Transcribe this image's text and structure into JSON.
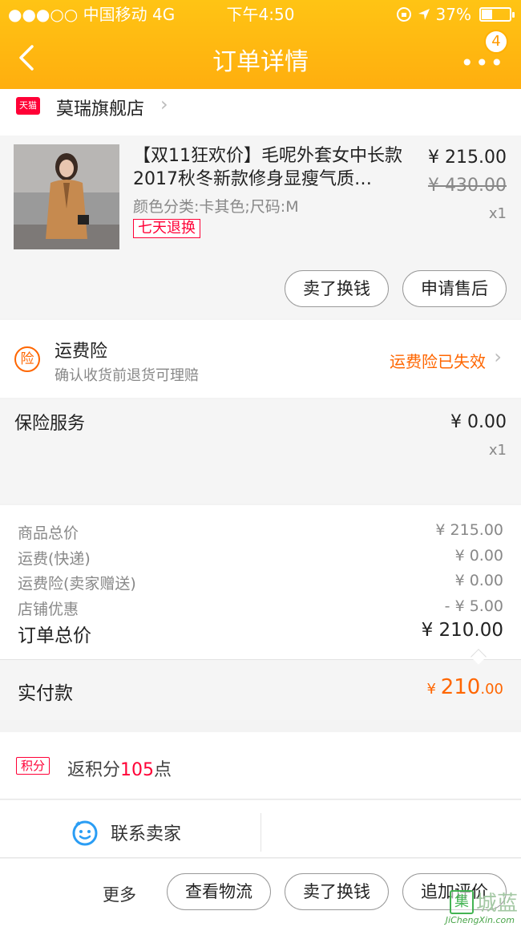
{
  "status_bar": {
    "carrier": "●●●○○ 中国移动   4G",
    "time": "下午4:50",
    "battery": "37%",
    "battery_level": 0.37
  },
  "nav": {
    "title": "订单详情",
    "more": "•••",
    "badge": "4"
  },
  "shop": {
    "tmall_label": "天猫",
    "name": "莫瑞旗舰店"
  },
  "product": {
    "title": "【双11狂欢价】毛呢外套女中长款2017秋冬新款修身显瘦气质…",
    "spec": "颜色分类:卡其色;尺码:M",
    "tag": "七天退换",
    "price": "¥ 215.00",
    "old_price": "¥ 430.00",
    "qty": "x1",
    "btn_sell": "卖了换钱",
    "btn_after_sale": "申请售后"
  },
  "insurance": {
    "icon": "险",
    "title": "运费险",
    "subtitle": "确认收货前退货可理赔",
    "status": "运费险已失效"
  },
  "service": {
    "title": "保险服务",
    "price": "¥ 0.00",
    "qty": "x1"
  },
  "summary": {
    "rows": [
      {
        "label": "商品总价",
        "value": "¥ 215.00"
      },
      {
        "label": "运费(快递)",
        "value": "¥ 0.00"
      },
      {
        "label": "运费险(卖家赠送)",
        "value": "¥ 0.00"
      },
      {
        "label": "店铺优惠",
        "value": "- ¥ 5.00"
      }
    ],
    "total_label": "订单总价",
    "total_value": "¥ 210.00"
  },
  "paid": {
    "label": "实付款",
    "currency": "¥ ",
    "integer": "210",
    "decimal": ".00"
  },
  "points": {
    "icon": "积分",
    "prefix": "返积分",
    "amount": "105",
    "suffix": "点"
  },
  "contact": {
    "label": "联系卖家"
  },
  "actions": {
    "more": "更多",
    "logistics": "查看物流",
    "sell": "卖了换钱",
    "review": "追加评价"
  },
  "watermark": {
    "logo": "集",
    "text": "城蓝",
    "url": "JiChengXin.com"
  },
  "colors": {
    "header": "#ffb20f",
    "orange": "#ff6600",
    "tmall_red": "#ff0036"
  }
}
